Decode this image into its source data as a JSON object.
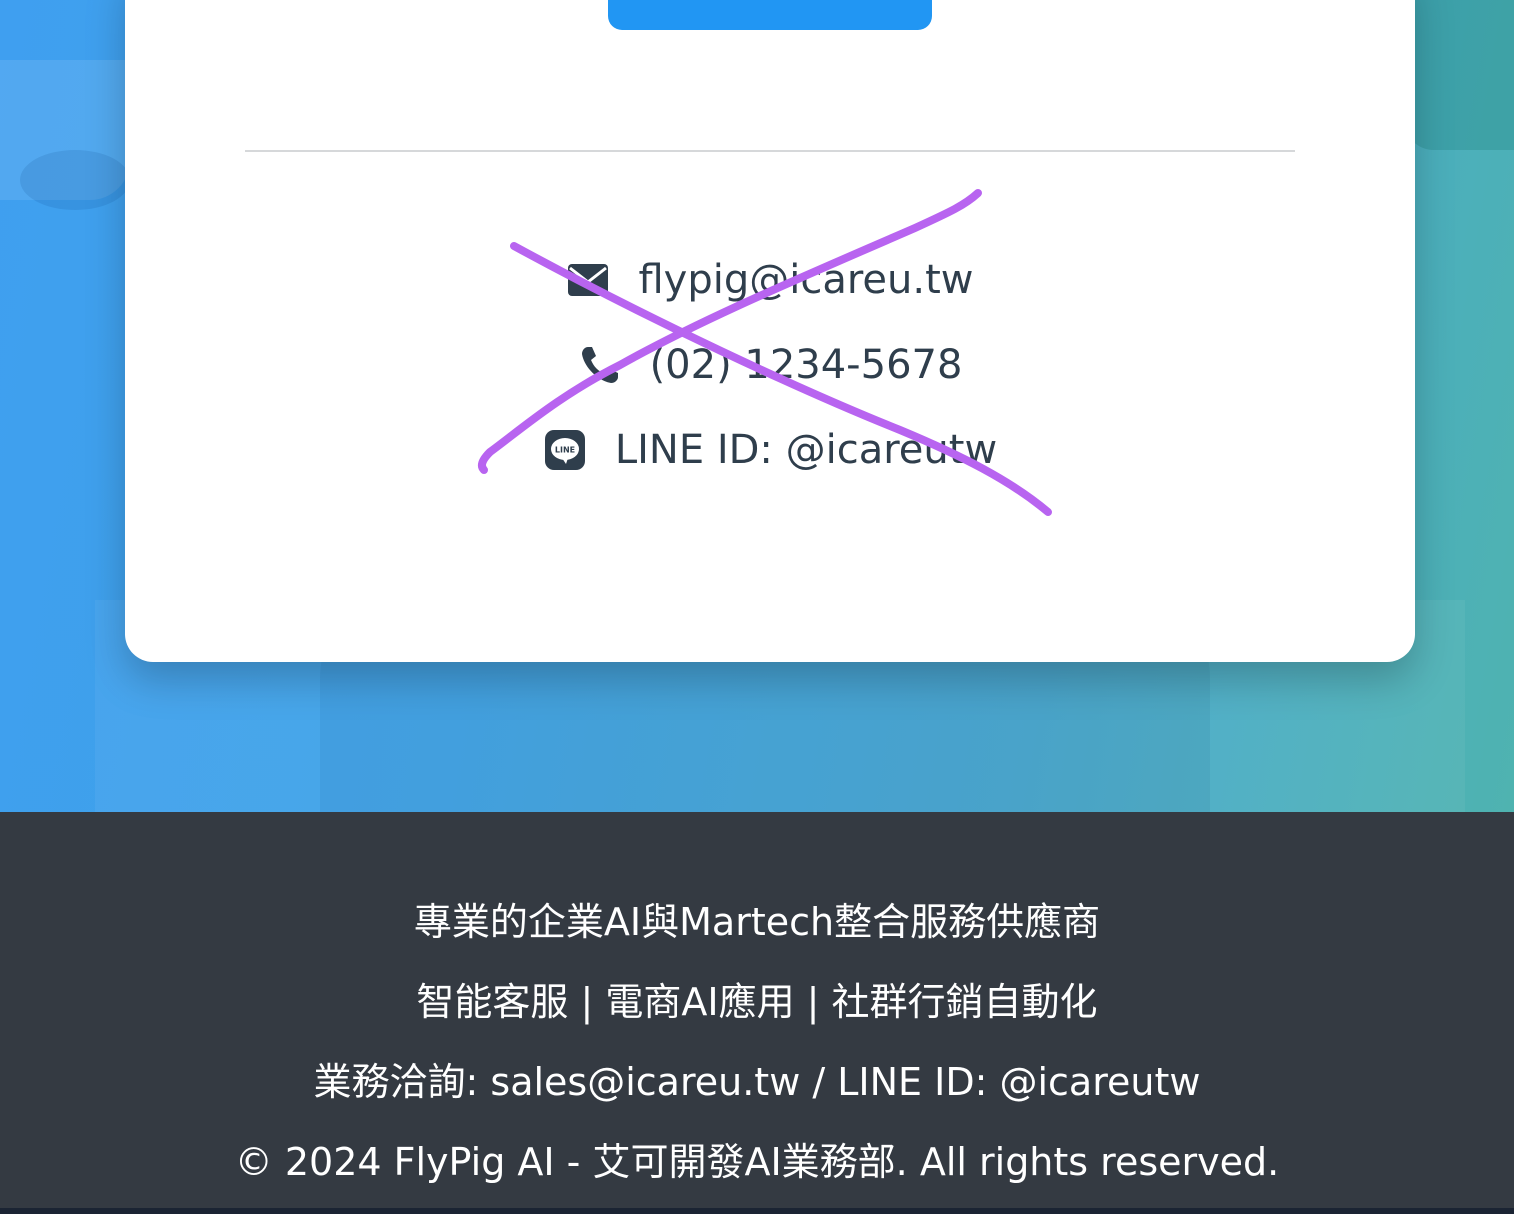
{
  "contact": {
    "email": "flypig@icareu.tw",
    "phone": "(02) 1234-5678",
    "line": "LINE ID: @icareutw",
    "line_badge": "LINE"
  },
  "footer": {
    "tagline": "專業的企業AI與Martech整合服務供應商",
    "services": "智能客服 | 電商AI應用 | 社群行銷自動化",
    "sales": "業務洽詢: sales@icareu.tw / LINE ID: @icareutw",
    "copyright": "© 2024 FlyPig AI - 艾可開發AI業務部. All rights reserved."
  },
  "colors": {
    "button": "#2196f3",
    "footer_bg": "#343a42",
    "contact_text": "#2f3e4c",
    "scribble": "#b864f0"
  },
  "icons": {
    "email": "envelope-icon",
    "phone": "phone-icon",
    "line": "line-app-icon"
  }
}
